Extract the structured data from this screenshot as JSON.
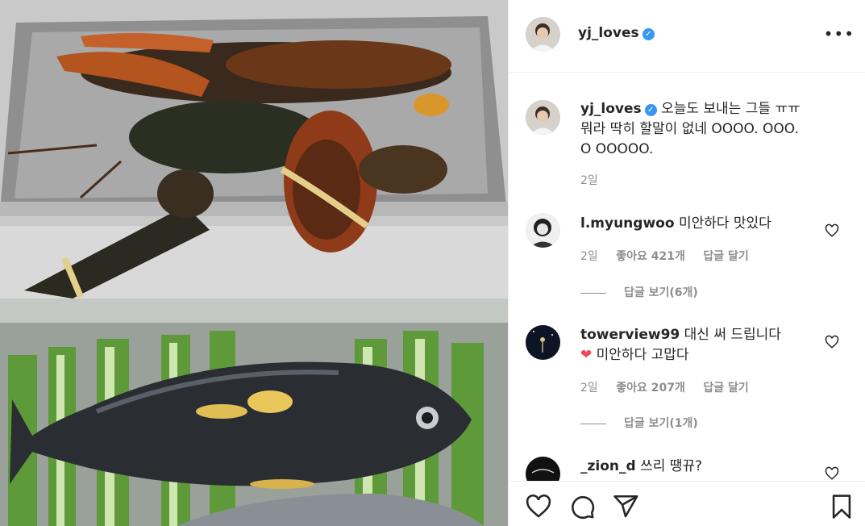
{
  "post": {
    "username": "yj_loves",
    "verified": true,
    "more_label": "•••"
  },
  "caption": {
    "username": "yj_loves",
    "text_line1": "오늘도 보내는 그들 ㅠㅠ",
    "text_line2": "뭐라 딱히 할말이 없네 OOOO. OOO.",
    "text_line3": "O OOOOO.",
    "time": "2일"
  },
  "comments": [
    {
      "username": "l.myungwoo",
      "text": "미안하다 맛있다",
      "time": "2일",
      "likes": "좋아요 421개",
      "reply_label": "답글 달기",
      "view_replies": "답글 보기(6개)"
    },
    {
      "username": "towerview99",
      "text": "대신 써 드립니다",
      "text2": "미안하다 고맙다",
      "heart_emoji": "❤",
      "time": "2일",
      "likes": "좋아요 207개",
      "reply_label": "답글 달기",
      "view_replies": "답글 보기(1개)"
    },
    {
      "username": "_zion_d",
      "text": "쓰리 땡뀨?"
    }
  ],
  "icons": {
    "like": "heart-icon",
    "comment": "comment-icon",
    "share": "paper-plane-icon",
    "save": "bookmark-icon"
  },
  "colors": {
    "verified_blue": "#3897f0",
    "meta_gray": "#8e8e8e",
    "text_dark": "#262626",
    "heart_red": "#ed4956"
  }
}
